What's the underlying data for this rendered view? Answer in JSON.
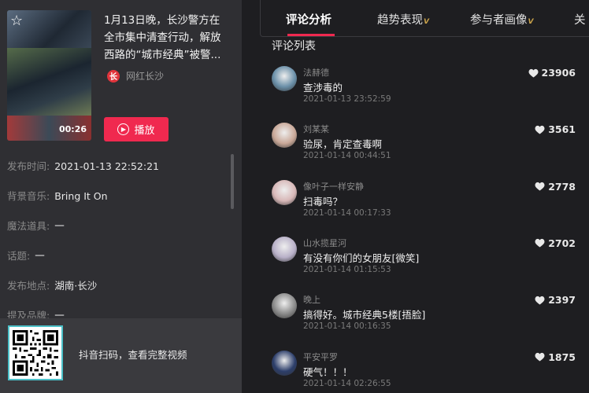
{
  "video": {
    "title": "1月13日晚，长沙警方在全市集中清查行动，解放西路的“城市经典”被警...",
    "duration": "00:26",
    "author": "网红长沙",
    "play_label": "播放"
  },
  "meta": [
    {
      "label": "发布时间:",
      "value": "2021-01-13 22:52:21"
    },
    {
      "label": "背景音乐:",
      "value": "Bring It On"
    },
    {
      "label": "魔法道具:",
      "value": "一"
    },
    {
      "label": "话题:",
      "value": "一"
    },
    {
      "label": "发布地点:",
      "value": "湖南·长沙"
    },
    {
      "label": "提及品牌:",
      "value": "一"
    }
  ],
  "qr_text": "抖音扫码，查看完整视频",
  "tabs": [
    {
      "label": "评论分析",
      "vip": ""
    },
    {
      "label": "趋势表现",
      "vip": "V"
    },
    {
      "label": "参与者画像",
      "vip": "V"
    },
    {
      "label": "关",
      "vip": ""
    }
  ],
  "section_title": "评论列表",
  "comments": [
    {
      "name": "法赫德",
      "text": "查涉毒的",
      "time": "2021-01-13 23:52:59",
      "likes": "23906",
      "avatar_color": "#6a8fa8"
    },
    {
      "name": "刘某某",
      "text": "验尿，肯定查毒啊",
      "time": "2021-01-14 00:44:51",
      "likes": "3561",
      "avatar_color": "#c9a898"
    },
    {
      "name": "像叶子一样安静",
      "text": "扫毒吗？",
      "time": "2021-01-14 00:17:33",
      "likes": "2778",
      "avatar_color": "#d8b8b8"
    },
    {
      "name": "山水揽星河",
      "text": "有没有你们的女朋友[微笑]",
      "time": "2021-01-14 01:15:53",
      "likes": "2702",
      "avatar_color": "#b8b0c8"
    },
    {
      "name": "晚上",
      "text": "搞得好。城市经典5楼[捂脸]",
      "time": "2021-01-14 00:16:35",
      "likes": "2397",
      "avatar_color": "#8a8a8a"
    },
    {
      "name": "平安平罗",
      "text": "硬气！！！",
      "time": "2021-01-14 02:26:55",
      "likes": "1875",
      "avatar_color": "#2c3e6a"
    }
  ]
}
